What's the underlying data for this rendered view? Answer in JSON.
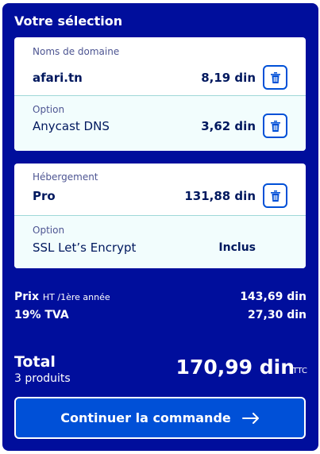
{
  "panel": {
    "title": "Votre sélection"
  },
  "domain_card": {
    "caption": "Noms de domaine",
    "domain_name": "afari.tn",
    "domain_price": "8,19 din",
    "option_caption": "Option",
    "option_name": "Anycast DNS",
    "option_price": "3,62 din"
  },
  "hosting_card": {
    "caption": "Hébergement",
    "plan_name": "Pro",
    "plan_price": "131,88 din",
    "option_caption": "Option",
    "option_name": "SSL Let’s Encrypt",
    "option_price": "Inclus"
  },
  "summary": {
    "price_label": "Prix",
    "price_suffix": "HT /1ère année",
    "price_value": "143,69 din",
    "tax_label": "19% TVA",
    "tax_value": "27,30 din",
    "total_label": "Total",
    "total_products": "3 produits",
    "total_value": "170,99 din",
    "total_suffix": "TTC"
  },
  "cta": {
    "label": "Continuer la commande"
  },
  "icons": {
    "trash": "trash-icon",
    "arrow": "arrow-right-icon"
  },
  "colors": {
    "panel_bg": "#000e9c",
    "accent": "#0050d7",
    "text_dark": "#00185e",
    "sub_row_bg": "#f2fdfd"
  }
}
